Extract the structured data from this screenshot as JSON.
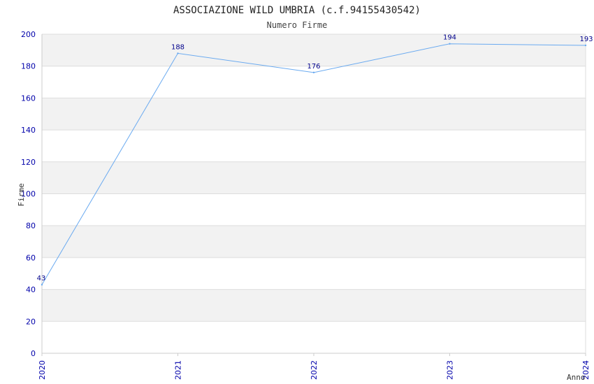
{
  "chart_data": {
    "type": "line",
    "title": "ASSOCIAZIONE WILD UMBRIA (c.f.94155430542)",
    "subtitle": "Numero Firme",
    "xlabel": "Anno",
    "ylabel": "Firme",
    "categories": [
      "2020",
      "2021",
      "2022",
      "2023",
      "2024"
    ],
    "series": [
      {
        "values": [
          43,
          188,
          176,
          194,
          193
        ],
        "labels": [
          "43",
          "188",
          "176",
          "194",
          "193"
        ]
      }
    ],
    "ylim": [
      0,
      200
    ],
    "yticks": [
      "0",
      "20",
      "40",
      "60",
      "80",
      "100",
      "120",
      "140",
      "160",
      "180",
      "200"
    ],
    "grid": true,
    "colors": {
      "line": "#6aaaf0",
      "tick_text": "#0000aa",
      "data_label": "#00008b",
      "band_shaded": "#f2f2f2",
      "grid": "#dddddd",
      "axis_text": "#333333"
    }
  }
}
